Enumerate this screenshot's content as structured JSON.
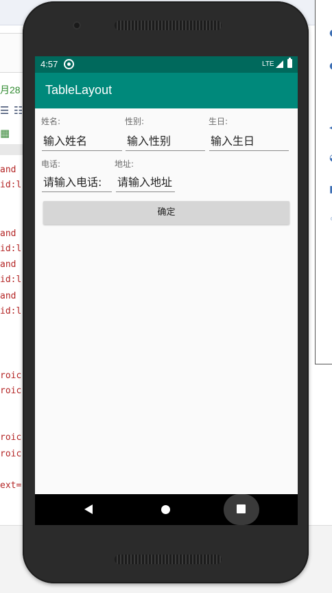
{
  "ide": {
    "date_fragment": "月28",
    "code_fragments": [
      "and",
      "id:l",
      "and",
      "id:l",
      "and",
      "id:l",
      "and",
      "id:l",
      "roic",
      "roic",
      "roic",
      "roic",
      "ext="
    ]
  },
  "status_bar": {
    "time": "4:57",
    "network": "LTE"
  },
  "app_bar": {
    "title": "TableLayout"
  },
  "form": {
    "row1": [
      {
        "label": "姓名:",
        "input_text": "输入姓名"
      },
      {
        "label": "性别:",
        "input_text": "输入性别"
      },
      {
        "label": "生日:",
        "input_text": "输入生日"
      }
    ],
    "row2": [
      {
        "label": "电话:",
        "input_text": "请输入电话:"
      },
      {
        "label": "地址:",
        "input_text": "请输入地址"
      }
    ],
    "confirm_label": "确定"
  },
  "nav_bar": {
    "icons": [
      "back-icon",
      "home-icon",
      "recents-icon"
    ]
  },
  "colors": {
    "status_bar": "#00695c",
    "app_bar": "#00897b",
    "button": "#d6d6d6"
  }
}
